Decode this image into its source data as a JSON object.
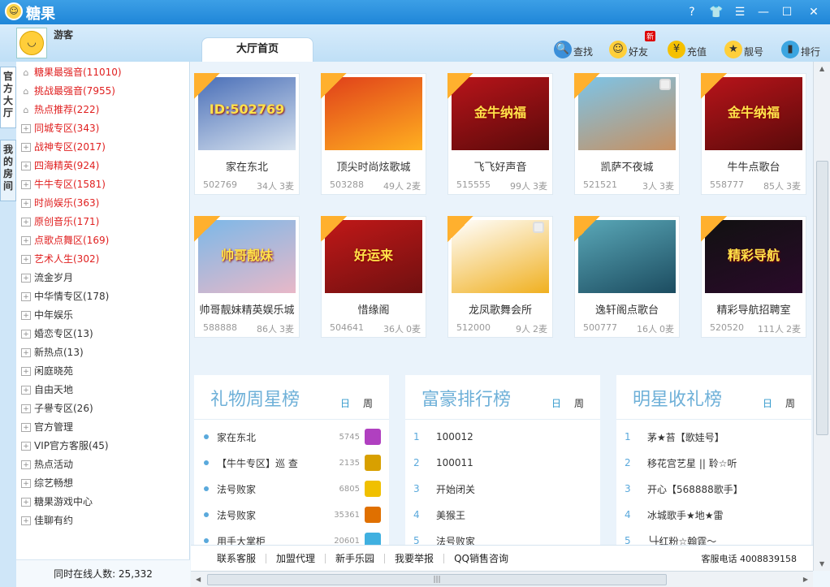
{
  "app": {
    "title": "糖果"
  },
  "user": {
    "name": "游客"
  },
  "main_tab": "大厅首页",
  "toolbar": [
    {
      "label": "查找",
      "icon": "magnifier-icon",
      "color": "#3b8fd9",
      "glyph": "🔍"
    },
    {
      "label": "好友",
      "icon": "friend-face-icon",
      "color": "#ffcf3a",
      "glyph": "☺",
      "badge": "新"
    },
    {
      "label": "充值",
      "icon": "yuan-coin-icon",
      "color": "#f5c000",
      "glyph": "¥"
    },
    {
      "label": "靓号",
      "icon": "medal-icon",
      "color": "#ffcf3a",
      "glyph": "★"
    },
    {
      "label": "排行",
      "icon": "bar-chart-icon",
      "color": "#3ba5e0",
      "glyph": "▮"
    }
  ],
  "vtabs": [
    {
      "label": "官方大厅"
    },
    {
      "label": "我的房间"
    }
  ],
  "sidebar": {
    "items": [
      {
        "label": "糖果最强音(11010)",
        "red": true,
        "icon": "home"
      },
      {
        "label": "挑战最强音(7955)",
        "red": true,
        "icon": "home"
      },
      {
        "label": "热点推荐(222)",
        "red": true,
        "icon": "home"
      },
      {
        "label": "同城专区(343)",
        "red": true,
        "icon": "box"
      },
      {
        "label": "战神专区(2017)",
        "red": true,
        "icon": "box"
      },
      {
        "label": "四海精英(924)",
        "red": true,
        "icon": "box"
      },
      {
        "label": "牛牛专区(1581)",
        "red": true,
        "icon": "box"
      },
      {
        "label": "时尚娱乐(363)",
        "red": true,
        "icon": "box"
      },
      {
        "label": "原创音乐(171)",
        "red": true,
        "icon": "box"
      },
      {
        "label": "点歌点舞区(169)",
        "red": true,
        "icon": "box"
      },
      {
        "label": "艺术人生(302)",
        "red": true,
        "icon": "box"
      },
      {
        "label": "流金岁月",
        "red": false,
        "icon": "box"
      },
      {
        "label": "中华情专区(178)",
        "red": false,
        "icon": "box"
      },
      {
        "label": "中年娱乐",
        "red": false,
        "icon": "box"
      },
      {
        "label": "婚恋专区(13)",
        "red": false,
        "icon": "box"
      },
      {
        "label": "新热点(13)",
        "red": false,
        "icon": "box"
      },
      {
        "label": "闲庭晓苑",
        "red": false,
        "icon": "box"
      },
      {
        "label": "自由天地",
        "red": false,
        "icon": "box"
      },
      {
        "label": "子譽专区(26)",
        "red": false,
        "icon": "box"
      },
      {
        "label": "官方管理",
        "red": false,
        "icon": "box"
      },
      {
        "label": "VIP官方客服(45)",
        "red": false,
        "icon": "box"
      },
      {
        "label": "热点活动",
        "red": false,
        "icon": "box"
      },
      {
        "label": "综艺畅想",
        "red": false,
        "icon": "box"
      },
      {
        "label": "糖果游戏中心",
        "red": false,
        "icon": "box"
      },
      {
        "label": "佳聊有约",
        "red": false,
        "icon": "box"
      }
    ],
    "online_text": "同时在线人数: 25,332"
  },
  "rooms": [
    {
      "name": "家在东北",
      "id": "502769",
      "people": "34人",
      "mics": "3麦",
      "bg": "#4a6fb8",
      "bg2": "#d8e3ef",
      "thumb_text": "ID:502769",
      "lock": false
    },
    {
      "name": "顶尖时尚炫歌城",
      "id": "503288",
      "people": "49人",
      "mics": "2麦",
      "bg": "#e0401a",
      "bg2": "#ffb020",
      "thumb_text": "",
      "lock": false
    },
    {
      "name": "飞飞好声音",
      "id": "515555",
      "people": "99人",
      "mics": "3麦",
      "bg": "#b8141a",
      "bg2": "#5a0a0a",
      "thumb_text": "金牛纳福",
      "lock": false
    },
    {
      "name": "凯萨不夜城",
      "id": "521521",
      "people": "3人",
      "mics": "3麦",
      "bg": "#7cc4e8",
      "bg2": "#c89060",
      "thumb_text": "",
      "lock": true
    },
    {
      "name": "牛牛点歌台",
      "id": "558777",
      "people": "85人",
      "mics": "3麦",
      "bg": "#b8141a",
      "bg2": "#5a0a0a",
      "thumb_text": "金牛纳福",
      "lock": false
    },
    {
      "name": "帅哥靓妹精英娱乐城",
      "id": "588888",
      "people": "86人",
      "mics": "3麦",
      "bg": "#7cb8e8",
      "bg2": "#e8b8c8",
      "thumb_text": "帅哥靓妹",
      "lock": false
    },
    {
      "name": "惜缘阁",
      "id": "504641",
      "people": "36人",
      "mics": "0麦",
      "bg": "#c01818",
      "bg2": "#701010",
      "thumb_text": "好运来",
      "lock": false
    },
    {
      "name": "龙凤歌舞会所",
      "id": "512000",
      "people": "9人",
      "mics": "2麦",
      "bg": "#ffffff",
      "bg2": "#f0b020",
      "thumb_text": "",
      "lock": true
    },
    {
      "name": "逸轩阁点歌台",
      "id": "500777",
      "people": "16人",
      "mics": "0麦",
      "bg": "#5aa8b8",
      "bg2": "#1c4c60",
      "thumb_text": "",
      "lock": false
    },
    {
      "name": "精彩导航招聘室",
      "id": "520520",
      "people": "111人",
      "mics": "2麦",
      "bg": "#111111",
      "bg2": "#2a0a2a",
      "thumb_text": "精彩导航",
      "lock": false
    }
  ],
  "panels": [
    {
      "title": "礼物周星榜",
      "day": "日",
      "week": "周",
      "style": "bullet",
      "rows": [
        {
          "name": "家在东北",
          "num": "5745",
          "gift": "#b040c0"
        },
        {
          "name": "【牛牛专区】巡 查",
          "num": "2135",
          "gift": "#d8a000"
        },
        {
          "name": "法号败家",
          "num": "6805",
          "gift": "#f0c000"
        },
        {
          "name": "法号败家",
          "num": "35361",
          "gift": "#e07000"
        },
        {
          "name": "用手大掌柜",
          "num": "20601",
          "gift": "#40b0e0"
        }
      ]
    },
    {
      "title": "富豪排行榜",
      "day": "日",
      "week": "周",
      "style": "rank",
      "rows": [
        {
          "rank": "1",
          "name": "100012"
        },
        {
          "rank": "2",
          "name": "100011"
        },
        {
          "rank": "3",
          "name": "开始闭关"
        },
        {
          "rank": "4",
          "name": "美猴王"
        },
        {
          "rank": "5",
          "name": "法号败家"
        }
      ]
    },
    {
      "title": "明星收礼榜",
      "day": "日",
      "week": "周",
      "style": "rank",
      "rows": [
        {
          "rank": "1",
          "name": "茅★苔【歌娃号】"
        },
        {
          "rank": "2",
          "name": "移花宫艺星 || 聆☆听"
        },
        {
          "rank": "3",
          "name": "开心【568888歌手】"
        },
        {
          "rank": "4",
          "name": "冰城歌手★地★雷"
        },
        {
          "rank": "5",
          "name": "╰┼红粉☆翰霆～"
        }
      ]
    }
  ],
  "footer": {
    "links": [
      "联系客服",
      "加盟代理",
      "新手乐园",
      "我要举报",
      "QQ销售咨询"
    ],
    "hotline": "客服电话 4008839158"
  },
  "colors": {
    "accent": "#1f86d8",
    "red": "#e02020",
    "rank_blue": "#5aa9dc"
  }
}
